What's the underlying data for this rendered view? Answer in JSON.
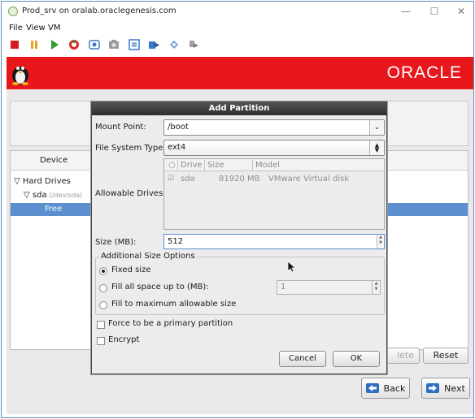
{
  "window": {
    "title": "Prod_srv on oralab.oraclegenesis.com",
    "minimize": "—",
    "maximize": "☐",
    "close": "✕"
  },
  "menu": [
    "File",
    "View",
    "VM"
  ],
  "toolbar": [
    {
      "name": "stop-icon",
      "color": "#d81c1c"
    },
    {
      "name": "pause-icon",
      "color": "#e8a21c"
    },
    {
      "name": "play-icon",
      "color": "#2ea02e"
    },
    {
      "name": "refresh-icon",
      "color": "#d0302a"
    },
    {
      "name": "snapshot-icon",
      "color": "#3a7ac8"
    },
    {
      "name": "screenshot-icon",
      "color": "#8a8a8a"
    },
    {
      "name": "fullscreen-icon",
      "color": "#3a7ac8"
    },
    {
      "name": "send-keys-icon",
      "color": "#3a7ac8"
    },
    {
      "name": "usb-icon",
      "color": "#3a7ac8"
    },
    {
      "name": "settings-icon",
      "color": "#888888"
    }
  ],
  "banner": {
    "logo_text": "ORACLE",
    "bg_color": "#e8171c"
  },
  "device_panel": {
    "header": "Device",
    "tree": {
      "hard_drives": "Hard Drives",
      "sda": "sda",
      "sda_path": "(/dev/sda)",
      "free": "Free"
    }
  },
  "background_buttons": {
    "delete_partial": "lete",
    "reset": "Reset"
  },
  "nav": {
    "back": "Back",
    "next": "Next"
  },
  "dialog": {
    "title": "Add Partition",
    "mount_point_label": "Mount Point:",
    "mount_point_value": "/boot",
    "fs_type_label": "File System Type:",
    "fs_type_value": "ext4",
    "allowable_drives_label": "Allowable Drives:",
    "drives_columns": [
      "Drive",
      "Size",
      "Model"
    ],
    "drives_rows": [
      {
        "drive": "sda",
        "size": "81920 MB",
        "model": "VMware Virtual disk",
        "checked": true
      }
    ],
    "size_label": "Size (MB):",
    "size_value": "512",
    "options_legend": "Additional Size Options",
    "opt_fixed": "Fixed size",
    "opt_fill_upto": "Fill all space up to (MB):",
    "fill_upto_value": "1",
    "opt_fill_max": "Fill to maximum allowable size",
    "force_primary": "Force to be a primary partition",
    "encrypt": "Encrypt",
    "cancel": "Cancel",
    "ok": "OK"
  }
}
